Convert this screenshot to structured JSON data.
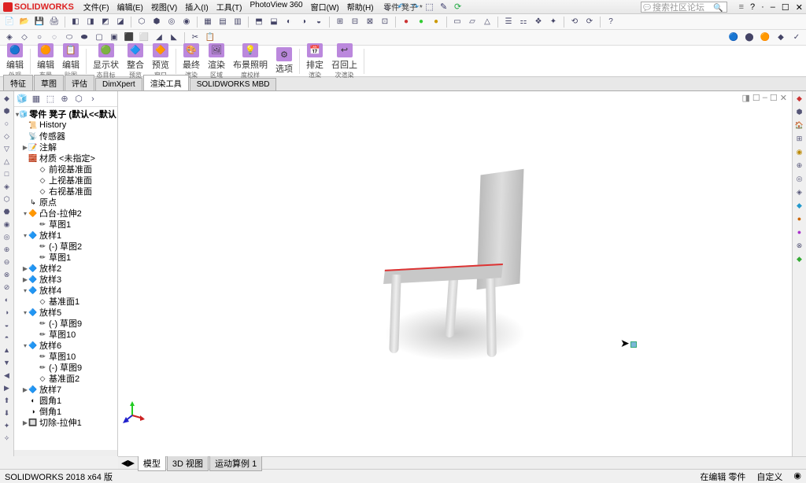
{
  "app": {
    "name": "SOLIDWORKS",
    "title": "零件 凳子 *",
    "version": "SOLIDWORKS 2018 x64 版"
  },
  "search": {
    "placeholder": "搜索社区论坛"
  },
  "menu": [
    "文件(F)",
    "编辑(E)",
    "视图(V)",
    "插入(I)",
    "工具(T)",
    "PhotoView 360",
    "窗口(W)",
    "帮助(H)"
  ],
  "win_controls": {
    "help": "?",
    "min": "–",
    "max": "☐",
    "close": "✕"
  },
  "cmd_bar": {
    "groups": [
      [
        {
          "label": "编辑",
          "sub": "外观",
          "icon": "🔵"
        }
      ],
      [
        {
          "label": "编辑",
          "sub": "布景",
          "icon": "🟠"
        },
        {
          "label": "编辑",
          "sub": "贴图",
          "icon": "📋"
        }
      ],
      [
        {
          "label": "显示状",
          "sub": "态目标",
          "icon": "🟢"
        },
        {
          "label": "整合",
          "sub": "预览",
          "icon": "🔷"
        },
        {
          "label": "预览",
          "sub": "窗口",
          "icon": "🔶"
        }
      ],
      [
        {
          "label": "最终",
          "sub": "渲染",
          "icon": "🎨"
        },
        {
          "label": "渲染",
          "sub": "区域",
          "icon": "🖼"
        },
        {
          "label": "布景照明",
          "sub": "度校样",
          "icon": "💡"
        },
        {
          "label": "选项",
          "sub": "",
          "icon": "⚙"
        }
      ],
      [
        {
          "label": "排定",
          "sub": "渲染",
          "icon": "📅"
        },
        {
          "label": "召回上",
          "sub": "次渲染",
          "icon": "↩"
        }
      ]
    ]
  },
  "tabs": [
    "特征",
    "草图",
    "评估",
    "DimXpert",
    "渲染工具",
    "SOLIDWORKS MBD"
  ],
  "tabs_active": 4,
  "tree": {
    "root": "零件 凳子  (默认<<默认",
    "items": [
      {
        "indent": 0,
        "exp": "",
        "icon": "📜",
        "label": "History"
      },
      {
        "indent": 0,
        "exp": "",
        "icon": "📡",
        "label": "传感器"
      },
      {
        "indent": 0,
        "exp": "▶",
        "icon": "📝",
        "label": "注解"
      },
      {
        "indent": 0,
        "exp": "",
        "icon": "🧱",
        "label": "材质 <未指定>"
      },
      {
        "indent": 1,
        "exp": "",
        "icon": "◇",
        "label": "前视基准面"
      },
      {
        "indent": 1,
        "exp": "",
        "icon": "◇",
        "label": "上视基准面"
      },
      {
        "indent": 1,
        "exp": "",
        "icon": "◇",
        "label": "右视基准面"
      },
      {
        "indent": 0,
        "exp": "",
        "icon": "↳",
        "label": "原点"
      },
      {
        "indent": 0,
        "exp": "▾",
        "icon": "🔶",
        "label": "凸台-拉伸2"
      },
      {
        "indent": 1,
        "exp": "",
        "icon": "✏",
        "label": "草图1"
      },
      {
        "indent": 0,
        "exp": "▾",
        "icon": "🔷",
        "label": "放样1"
      },
      {
        "indent": 1,
        "exp": "",
        "icon": "✏",
        "label": "(-) 草图2"
      },
      {
        "indent": 1,
        "exp": "",
        "icon": "✏",
        "label": "草图1"
      },
      {
        "indent": 0,
        "exp": "▶",
        "icon": "🔷",
        "label": "放样2"
      },
      {
        "indent": 0,
        "exp": "▶",
        "icon": "🔷",
        "label": "放样3"
      },
      {
        "indent": 0,
        "exp": "▾",
        "icon": "🔷",
        "label": "放样4"
      },
      {
        "indent": 1,
        "exp": "",
        "icon": "◇",
        "label": "基准面1"
      },
      {
        "indent": 0,
        "exp": "▾",
        "icon": "🔷",
        "label": "放样5"
      },
      {
        "indent": 1,
        "exp": "",
        "icon": "✏",
        "label": "(-) 草图9"
      },
      {
        "indent": 1,
        "exp": "",
        "icon": "✏",
        "label": "草图10"
      },
      {
        "indent": 0,
        "exp": "▾",
        "icon": "🔷",
        "label": "放样6"
      },
      {
        "indent": 1,
        "exp": "",
        "icon": "✏",
        "label": "草图10"
      },
      {
        "indent": 1,
        "exp": "",
        "icon": "✏",
        "label": "(-) 草图9"
      },
      {
        "indent": 1,
        "exp": "",
        "icon": "◇",
        "label": "基准面2"
      },
      {
        "indent": 0,
        "exp": "▶",
        "icon": "🔷",
        "label": "放样7"
      },
      {
        "indent": 0,
        "exp": "",
        "icon": "◐",
        "label": "圆角1"
      },
      {
        "indent": 0,
        "exp": "",
        "icon": "◑",
        "label": "倒角1"
      },
      {
        "indent": 0,
        "exp": "▶",
        "icon": "🔲",
        "label": "切除-拉伸1"
      }
    ]
  },
  "bottom_tabs": [
    "模型",
    "3D 视图",
    "运动算例 1"
  ],
  "bottom_active": 0,
  "status": {
    "left": "",
    "mode": "在编辑 零件",
    "custom": "自定义"
  }
}
